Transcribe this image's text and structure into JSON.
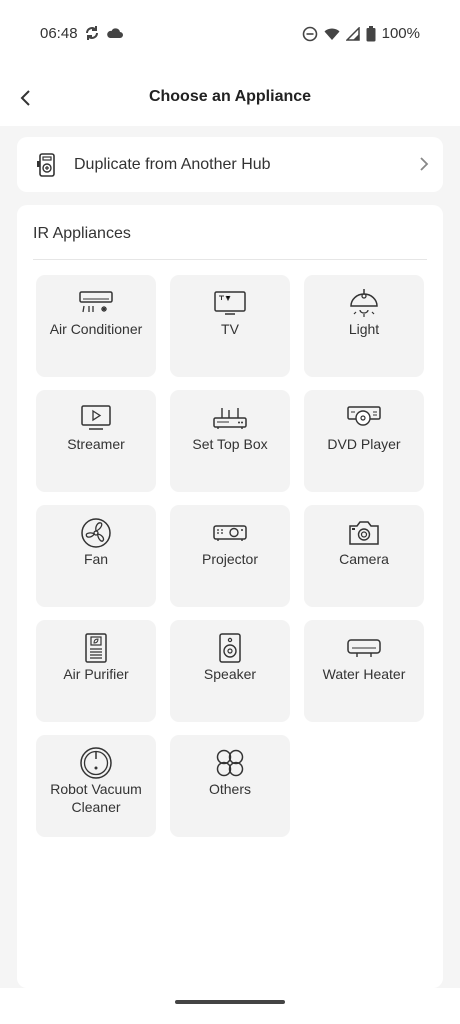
{
  "status": {
    "time": "06:48",
    "battery": "100%",
    "left_icons": [
      "sync-icon",
      "cloud-icon"
    ],
    "right_icons": [
      "dnd-icon",
      "wifi-icon",
      "signal-icon",
      "battery-icon"
    ]
  },
  "header": {
    "title": "Choose an Appliance",
    "back_icon": "back-icon"
  },
  "duplicate": {
    "label": "Duplicate from Another Hub",
    "icon": "hub-icon",
    "chevron": "chevron-right-icon"
  },
  "ir": {
    "title": "IR Appliances",
    "tiles": [
      {
        "label": "Air Conditioner",
        "icon": "air-conditioner-icon"
      },
      {
        "label": "TV",
        "icon": "tv-icon"
      },
      {
        "label": "Light",
        "icon": "light-icon"
      },
      {
        "label": "Streamer",
        "icon": "streamer-icon"
      },
      {
        "label": "Set Top Box",
        "icon": "set-top-box-icon"
      },
      {
        "label": "DVD Player",
        "icon": "dvd-player-icon"
      },
      {
        "label": "Fan",
        "icon": "fan-icon"
      },
      {
        "label": "Projector",
        "icon": "projector-icon"
      },
      {
        "label": "Camera",
        "icon": "camera-icon"
      },
      {
        "label": "Air Purifier",
        "icon": "air-purifier-icon"
      },
      {
        "label": "Speaker",
        "icon": "speaker-icon"
      },
      {
        "label": "Water Heater",
        "icon": "water-heater-icon"
      },
      {
        "label": "Robot Vacuum Cleaner",
        "icon": "robot-vacuum-icon"
      },
      {
        "label": "Others",
        "icon": "others-icon"
      }
    ]
  }
}
